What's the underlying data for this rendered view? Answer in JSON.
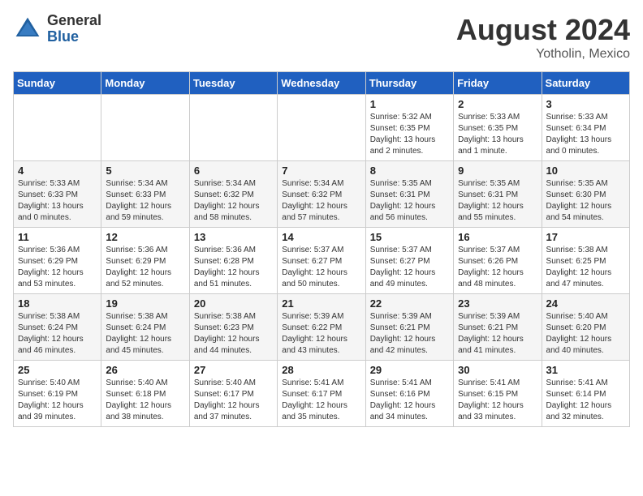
{
  "logo": {
    "general": "General",
    "blue": "Blue"
  },
  "title": "August 2024",
  "location": "Yotholin, Mexico",
  "days_header": [
    "Sunday",
    "Monday",
    "Tuesday",
    "Wednesday",
    "Thursday",
    "Friday",
    "Saturday"
  ],
  "weeks": [
    [
      {
        "num": "",
        "info": ""
      },
      {
        "num": "",
        "info": ""
      },
      {
        "num": "",
        "info": ""
      },
      {
        "num": "",
        "info": ""
      },
      {
        "num": "1",
        "info": "Sunrise: 5:32 AM\nSunset: 6:35 PM\nDaylight: 13 hours\nand 2 minutes."
      },
      {
        "num": "2",
        "info": "Sunrise: 5:33 AM\nSunset: 6:35 PM\nDaylight: 13 hours\nand 1 minute."
      },
      {
        "num": "3",
        "info": "Sunrise: 5:33 AM\nSunset: 6:34 PM\nDaylight: 13 hours\nand 0 minutes."
      }
    ],
    [
      {
        "num": "4",
        "info": "Sunrise: 5:33 AM\nSunset: 6:33 PM\nDaylight: 13 hours\nand 0 minutes."
      },
      {
        "num": "5",
        "info": "Sunrise: 5:34 AM\nSunset: 6:33 PM\nDaylight: 12 hours\nand 59 minutes."
      },
      {
        "num": "6",
        "info": "Sunrise: 5:34 AM\nSunset: 6:32 PM\nDaylight: 12 hours\nand 58 minutes."
      },
      {
        "num": "7",
        "info": "Sunrise: 5:34 AM\nSunset: 6:32 PM\nDaylight: 12 hours\nand 57 minutes."
      },
      {
        "num": "8",
        "info": "Sunrise: 5:35 AM\nSunset: 6:31 PM\nDaylight: 12 hours\nand 56 minutes."
      },
      {
        "num": "9",
        "info": "Sunrise: 5:35 AM\nSunset: 6:31 PM\nDaylight: 12 hours\nand 55 minutes."
      },
      {
        "num": "10",
        "info": "Sunrise: 5:35 AM\nSunset: 6:30 PM\nDaylight: 12 hours\nand 54 minutes."
      }
    ],
    [
      {
        "num": "11",
        "info": "Sunrise: 5:36 AM\nSunset: 6:29 PM\nDaylight: 12 hours\nand 53 minutes."
      },
      {
        "num": "12",
        "info": "Sunrise: 5:36 AM\nSunset: 6:29 PM\nDaylight: 12 hours\nand 52 minutes."
      },
      {
        "num": "13",
        "info": "Sunrise: 5:36 AM\nSunset: 6:28 PM\nDaylight: 12 hours\nand 51 minutes."
      },
      {
        "num": "14",
        "info": "Sunrise: 5:37 AM\nSunset: 6:27 PM\nDaylight: 12 hours\nand 50 minutes."
      },
      {
        "num": "15",
        "info": "Sunrise: 5:37 AM\nSunset: 6:27 PM\nDaylight: 12 hours\nand 49 minutes."
      },
      {
        "num": "16",
        "info": "Sunrise: 5:37 AM\nSunset: 6:26 PM\nDaylight: 12 hours\nand 48 minutes."
      },
      {
        "num": "17",
        "info": "Sunrise: 5:38 AM\nSunset: 6:25 PM\nDaylight: 12 hours\nand 47 minutes."
      }
    ],
    [
      {
        "num": "18",
        "info": "Sunrise: 5:38 AM\nSunset: 6:24 PM\nDaylight: 12 hours\nand 46 minutes."
      },
      {
        "num": "19",
        "info": "Sunrise: 5:38 AM\nSunset: 6:24 PM\nDaylight: 12 hours\nand 45 minutes."
      },
      {
        "num": "20",
        "info": "Sunrise: 5:38 AM\nSunset: 6:23 PM\nDaylight: 12 hours\nand 44 minutes."
      },
      {
        "num": "21",
        "info": "Sunrise: 5:39 AM\nSunset: 6:22 PM\nDaylight: 12 hours\nand 43 minutes."
      },
      {
        "num": "22",
        "info": "Sunrise: 5:39 AM\nSunset: 6:21 PM\nDaylight: 12 hours\nand 42 minutes."
      },
      {
        "num": "23",
        "info": "Sunrise: 5:39 AM\nSunset: 6:21 PM\nDaylight: 12 hours\nand 41 minutes."
      },
      {
        "num": "24",
        "info": "Sunrise: 5:40 AM\nSunset: 6:20 PM\nDaylight: 12 hours\nand 40 minutes."
      }
    ],
    [
      {
        "num": "25",
        "info": "Sunrise: 5:40 AM\nSunset: 6:19 PM\nDaylight: 12 hours\nand 39 minutes."
      },
      {
        "num": "26",
        "info": "Sunrise: 5:40 AM\nSunset: 6:18 PM\nDaylight: 12 hours\nand 38 minutes."
      },
      {
        "num": "27",
        "info": "Sunrise: 5:40 AM\nSunset: 6:17 PM\nDaylight: 12 hours\nand 37 minutes."
      },
      {
        "num": "28",
        "info": "Sunrise: 5:41 AM\nSunset: 6:17 PM\nDaylight: 12 hours\nand 35 minutes."
      },
      {
        "num": "29",
        "info": "Sunrise: 5:41 AM\nSunset: 6:16 PM\nDaylight: 12 hours\nand 34 minutes."
      },
      {
        "num": "30",
        "info": "Sunrise: 5:41 AM\nSunset: 6:15 PM\nDaylight: 12 hours\nand 33 minutes."
      },
      {
        "num": "31",
        "info": "Sunrise: 5:41 AM\nSunset: 6:14 PM\nDaylight: 12 hours\nand 32 minutes."
      }
    ]
  ]
}
